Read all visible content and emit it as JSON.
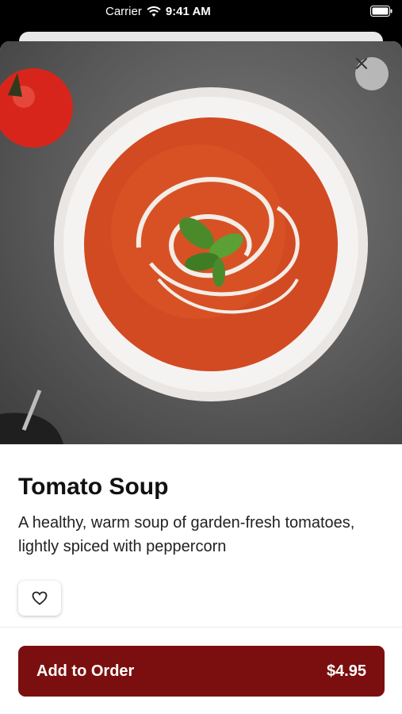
{
  "status_bar": {
    "carrier": "Carrier",
    "time": "9:41 AM"
  },
  "product": {
    "name": "Tomato Soup",
    "description": "A healthy, warm soup of garden-fresh tomatoes, lightly spiced with peppercorn"
  },
  "actions": {
    "order_label": "Add to Order",
    "price": "$4.95"
  },
  "icons": {
    "close": "close-icon",
    "favorite": "heart-icon"
  },
  "colors": {
    "accent": "#7b0f0f"
  }
}
